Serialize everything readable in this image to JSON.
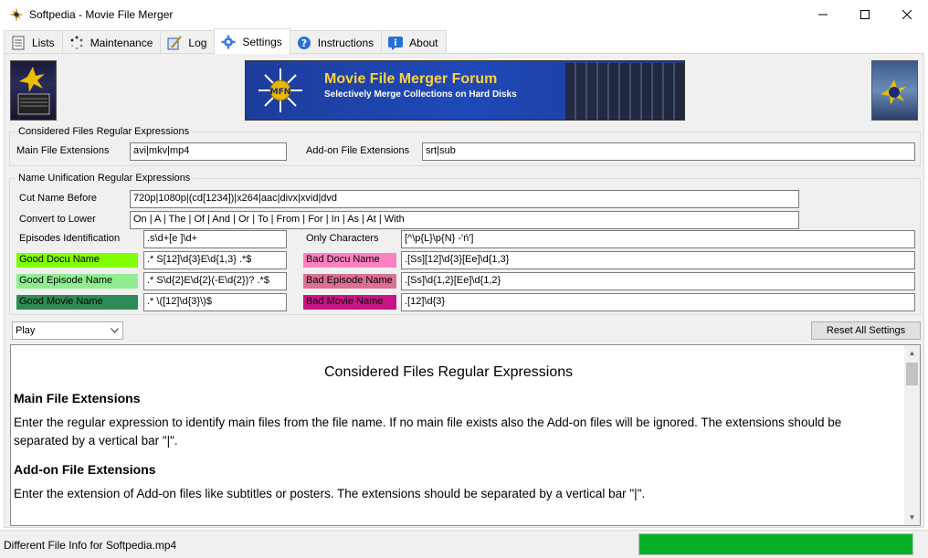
{
  "window": {
    "title": "Softpedia - Movie File Merger"
  },
  "tabs": [
    {
      "label": "Lists",
      "icon": "document-list-icon"
    },
    {
      "label": "Maintenance",
      "icon": "spinner-dots-icon"
    },
    {
      "label": "Log",
      "icon": "pen-notebook-icon"
    },
    {
      "label": "Settings",
      "icon": "gear-icon"
    },
    {
      "label": "Instructions",
      "icon": "question-icon"
    },
    {
      "label": "About",
      "icon": "info-icon"
    }
  ],
  "active_tab": "Settings",
  "banner": {
    "title": "Movie File Merger Forum",
    "subtitle": "Selectively Merge Collections on Hard Disks",
    "logo_text": "MFN"
  },
  "considered": {
    "legend": "Considered Files Regular Expressions",
    "main_label": "Main File Extensions",
    "main_value": "avi|mkv|mp4",
    "addon_label": "Add-on File Extensions",
    "addon_value": "srt|sub"
  },
  "unification": {
    "legend": "Name Unification Regular Expressions",
    "cut_label": "Cut Name Before",
    "cut_value": "720p|1080p|(cd[1234])|x264|aac|divx|xvid|dvd",
    "lower_label": "Convert to Lower",
    "lower_value": " On | A | The | Of | And | Or | To | From | For | In | As | At | With",
    "episodes_label": "Episodes Identification",
    "episodes_value": ".s\\d+[e ]\\d+",
    "only_label": "Only Characters",
    "only_value": "[^\\p{L}\\p{N} -'ń']",
    "good_docu_label": "Good Docu Name",
    "good_docu_value": ".* S[12]\\d{3}E\\d{1,3} .*$",
    "bad_docu_label": "Bad Docu Name",
    "bad_docu_value": ".[Ss][12]\\d{3}[Ee]\\d{1,3}",
    "good_episode_label": "Good Episode Name",
    "good_episode_value": ".* S\\d{2}E\\d{2}(-E\\d{2})? .*$",
    "bad_episode_label": "Bad Episode Name",
    "bad_episode_value": ".[Ss]\\d{1,2}[Ee]\\d{1,2}",
    "good_movie_label": "Good Movie Name",
    "good_movie_value": ".* \\([12]\\d{3}\\)$",
    "bad_movie_label": "Bad Movie Name",
    "bad_movie_value": ".[12]\\d{3}"
  },
  "colors": {
    "good_docu": "#80ff00",
    "bad_docu": "#ff80c0",
    "good_episode": "#90ee90",
    "bad_episode": "#db7093",
    "good_movie": "#2e8b57",
    "bad_movie": "#c71585"
  },
  "controls": {
    "play_select": "Play",
    "reset_button": "Reset All Settings"
  },
  "help": {
    "title": "Considered Files Regular Expressions",
    "h1": "Main File Extensions",
    "p1": "Enter the regular expression to identify main files from the file name.  If no main file exists also the Add-on files will be ignored.  The extensions should be separated by a vertical bar \"|\".",
    "h2": "Add-on File Extensions",
    "p2": "Enter the extension of Add-on files like subtitles or posters.  The extensions should be separated by a vertical bar \"|\"."
  },
  "status": {
    "text": "Different File Info for Softpedia.mp4",
    "progress": 1.0
  }
}
